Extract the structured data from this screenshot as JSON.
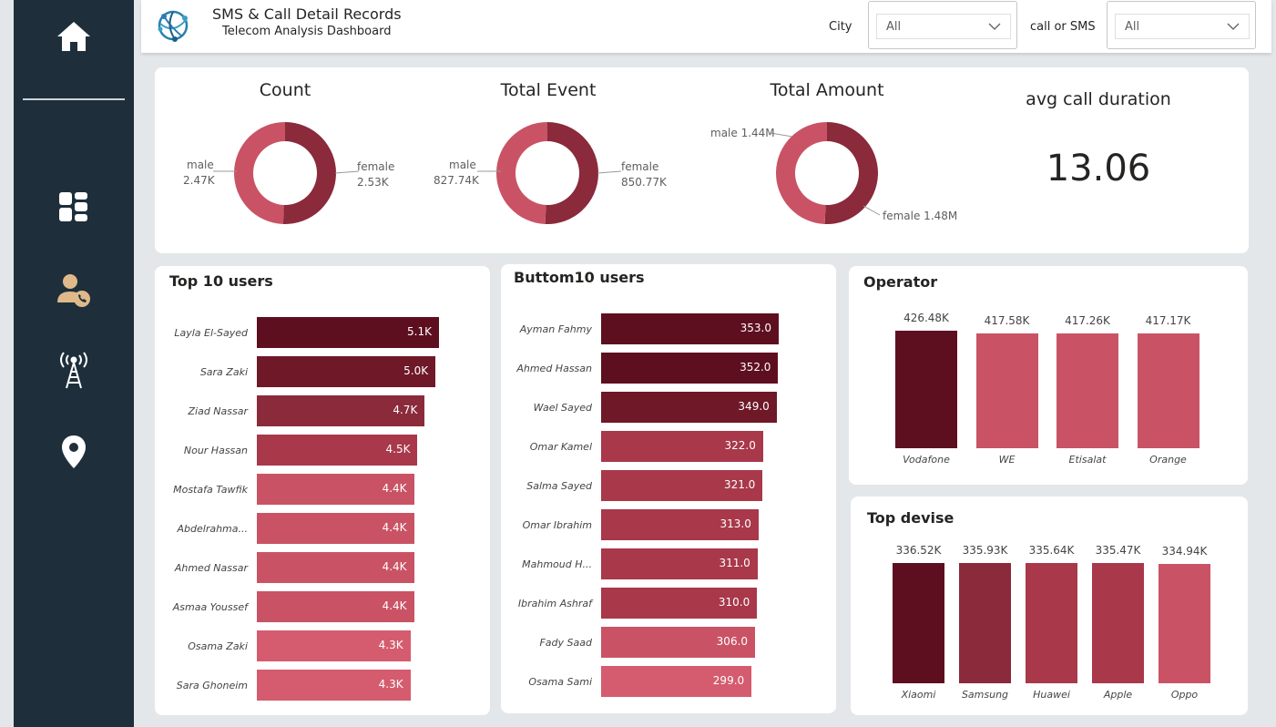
{
  "header": {
    "title": "SMS & Call Detail Records",
    "subtitle": "Telecom Analysis Dashboard",
    "filters": [
      {
        "label": "City",
        "value": "All"
      },
      {
        "label": "call or SMS",
        "value": "All"
      }
    ]
  },
  "sidebar": {
    "items": [
      {
        "icon": "home-icon"
      },
      {
        "icon": "dashboard-icon"
      },
      {
        "icon": "user-call-icon"
      },
      {
        "icon": "tower-icon"
      },
      {
        "icon": "location-icon"
      }
    ]
  },
  "colors": {
    "sidebar": "#1e2f3b",
    "dark": "#5e0f1f",
    "dark2": "#6e1828",
    "mid": "#8a2a3b",
    "mid2": "#a8384a",
    "light": "#c95365",
    "lighter": "#d45c6e"
  },
  "kpis": {
    "count": {
      "title": "Count",
      "male_label": "male",
      "male_value": "2.47K",
      "female_label": "female",
      "female_value": "2.53K",
      "male": 2.47,
      "female": 2.53
    },
    "total_event": {
      "title": "Total Event",
      "male_label": "male",
      "male_value": "827.74K",
      "female_label": "female",
      "female_value": "850.77K",
      "male": 827.74,
      "female": 850.77
    },
    "total_amount": {
      "title": "Total Amount",
      "male_text": "male 1.44M",
      "female_text": "female 1.48M",
      "male": 1.44,
      "female": 1.48
    },
    "avg_call": {
      "title": "avg call duration",
      "value": "13.06"
    }
  },
  "chart_data": [
    {
      "type": "bar",
      "title": "Top 10 users",
      "categories": [
        "Layla El-Sayed",
        "Sara Zaki",
        "Ziad Nassar",
        "Nour Hassan",
        "Mostafa Tawfik",
        "Abdelrahma...",
        "Ahmed Nassar",
        "Asmaa Youssef",
        "Osama Zaki",
        "Sara Ghoneim"
      ],
      "values": [
        5.1,
        5.0,
        4.7,
        4.5,
        4.4,
        4.4,
        4.4,
        4.4,
        4.3,
        4.3
      ],
      "labels": [
        "5.1K",
        "5.0K",
        "4.7K",
        "4.5K",
        "4.4K",
        "4.4K",
        "4.4K",
        "4.4K",
        "4.3K",
        "4.3K"
      ]
    },
    {
      "type": "bar",
      "title": "Buttom10 users",
      "categories": [
        "Ayman Fahmy",
        "Ahmed Hassan",
        "Wael Sayed",
        "Omar Kamel",
        "Salma Sayed",
        "Omar Ibrahim",
        "Mahmoud H...",
        "Ibrahim Ashraf",
        "Fady Saad",
        "Osama Sami"
      ],
      "values": [
        353.0,
        352.0,
        349.0,
        322.0,
        321.0,
        313.0,
        311.0,
        310.0,
        306.0,
        299.0
      ],
      "labels": [
        "353.0",
        "352.0",
        "349.0",
        "322.0",
        "321.0",
        "313.0",
        "311.0",
        "310.0",
        "306.0",
        "299.0"
      ]
    },
    {
      "type": "bar",
      "title": "Operator",
      "categories": [
        "Vodafone",
        "WE",
        "Etisalat",
        "Orange"
      ],
      "values": [
        426.48,
        417.58,
        417.26,
        417.17
      ],
      "labels": [
        "426.48K",
        "417.58K",
        "417.26K",
        "417.17K"
      ]
    },
    {
      "type": "bar",
      "title": "Top devise",
      "categories": [
        "Xiaomi",
        "Samsung",
        "Huawei",
        "Apple",
        "Oppo"
      ],
      "values": [
        336.52,
        335.93,
        335.64,
        335.47,
        334.94
      ],
      "labels": [
        "336.52K",
        "335.93K",
        "335.64K",
        "335.47K",
        "334.94K"
      ]
    }
  ]
}
